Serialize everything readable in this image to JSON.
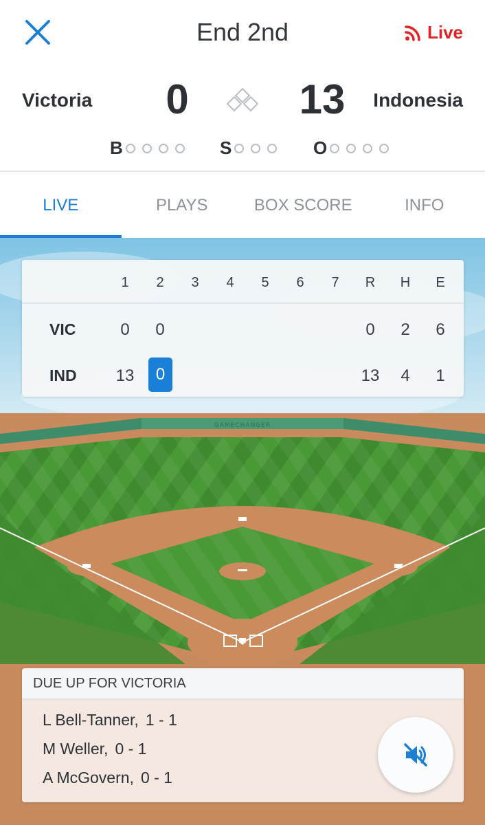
{
  "header": {
    "title": "End 2nd",
    "live_label": "Live",
    "close_icon": "close-icon",
    "live_icon": "broadcast-icon",
    "accent_color": "#1c7fd3",
    "live_color": "#e02424"
  },
  "score": {
    "away_team": "Victoria",
    "home_team": "Indonesia",
    "away_runs": "0",
    "home_runs": "13",
    "bases_icon": "bases-diamond-icon",
    "count": {
      "balls_label": "B",
      "strikes_label": "S",
      "outs_label": "O",
      "balls": 0,
      "strikes": 0,
      "outs": 0
    }
  },
  "tabs": [
    {
      "label": "LIVE",
      "active": true
    },
    {
      "label": "PLAYS",
      "active": false
    },
    {
      "label": "BOX SCORE",
      "active": false
    },
    {
      "label": "INFO",
      "active": false
    }
  ],
  "linescore": {
    "columns": [
      "1",
      "2",
      "3",
      "4",
      "5",
      "6",
      "7",
      "R",
      "H",
      "E"
    ],
    "rows": [
      {
        "team": "VIC",
        "innings": [
          "0",
          "0",
          "",
          "",
          "",
          "",
          ""
        ],
        "r": "0",
        "h": "2",
        "e": "6"
      },
      {
        "team": "IND",
        "innings": [
          "13",
          "0",
          "",
          "",
          "",
          "",
          ""
        ],
        "r": "13",
        "h": "4",
        "e": "1"
      }
    ],
    "current_inning_value": "0"
  },
  "field": {
    "wall_text": "GAMECHANGER"
  },
  "dueup": {
    "title": "DUE UP FOR VICTORIA",
    "batters": [
      {
        "name": "L Bell-Tanner,",
        "stat": "1 - 1"
      },
      {
        "name": "M Weller,",
        "stat": "0 - 1"
      },
      {
        "name": "A McGovern,",
        "stat": "0 - 1"
      }
    ],
    "mute_icon": "volume-muted-icon"
  }
}
